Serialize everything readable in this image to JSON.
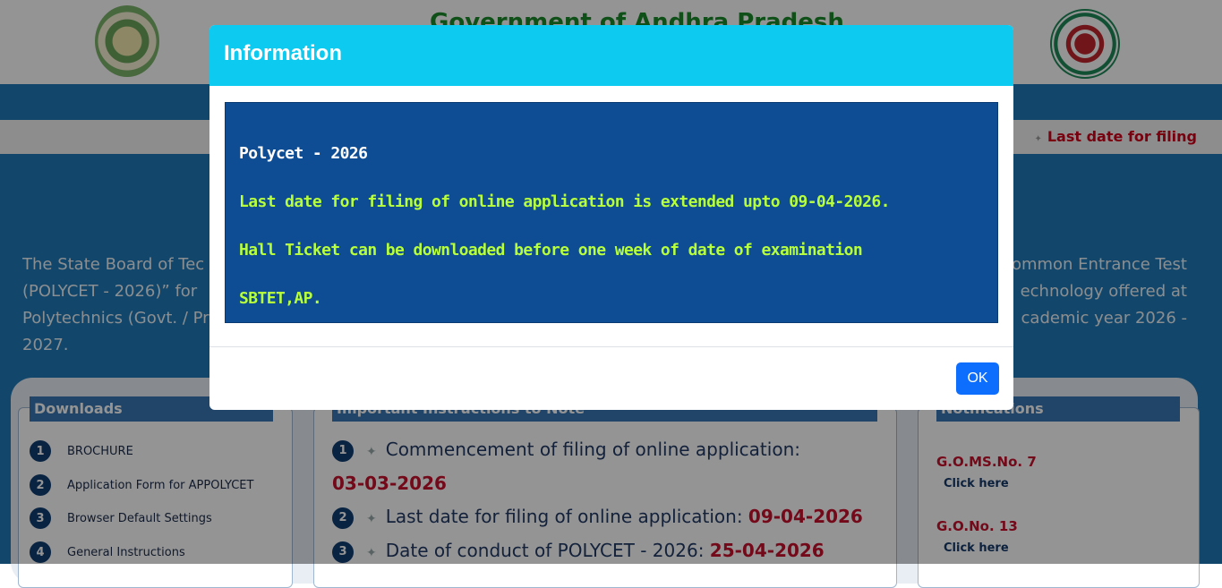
{
  "header": {
    "title": "Government of Andhra Pradesh",
    "logo_left_icon": "andhra-pradesh-emblem-icon",
    "logo_right_icon": "sbtet-seal-icon"
  },
  "ticker": {
    "text": "Last date for filing"
  },
  "hero": {
    "left_lines": [
      "The State Board of Tec",
      "(POLYCET - 2026)” for",
      "Polytechnics (Govt. / Pr",
      "2027."
    ],
    "right_lines": [
      "ommon Entrance Test",
      "echnology offered at",
      "cademic year 2026 -"
    ]
  },
  "downloads": {
    "heading": "Downloads",
    "items": [
      {
        "num": "1",
        "label": "BROCHURE"
      },
      {
        "num": "2",
        "label": "Application Form for APPOLYCET"
      },
      {
        "num": "3",
        "label": "Browser Default Settings"
      },
      {
        "num": "4",
        "label": "General Instructions"
      }
    ]
  },
  "instructions": {
    "heading": "Important Instructions to Note",
    "items": [
      {
        "num": "1",
        "text": "Commencement of filing of online application:",
        "date": "03-03-2026"
      },
      {
        "num": "2",
        "text": "Last date for filing of online application:",
        "date": "09-04-2026"
      },
      {
        "num": "3",
        "text": "Date of conduct of POLYCET - 2026:",
        "date": "25-04-2026"
      }
    ]
  },
  "notifications": {
    "heading": "Notifications",
    "items": [
      {
        "title": "G.O.MS.No. 7",
        "link": "Click here"
      },
      {
        "title": "G.O.No. 13",
        "link": "Click here"
      }
    ]
  },
  "modal": {
    "title": "Information",
    "line1": "Polycet - 2026",
    "line2": "Last date for filing of online application is extended upto 09-04-2026.",
    "line3": "Hall Ticket can be downloaded before one week of date of examination",
    "line4": "SBTET,AP.",
    "ok_label": "OK"
  },
  "colors": {
    "modal_header": "#0dcaf0",
    "modal_body": "#0e4c93",
    "highlight_text": "#b7ff3c",
    "primary_button": "#0d6efd",
    "hero_blue": "#1f7ab8",
    "accent_red": "#c8102e"
  }
}
